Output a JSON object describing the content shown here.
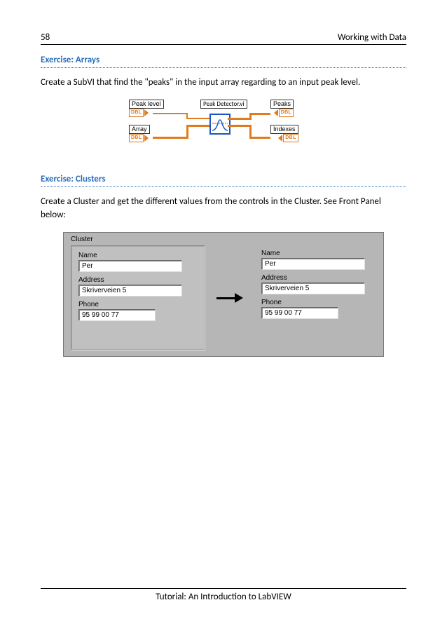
{
  "header": {
    "page_number": "58",
    "chapter": "Working with Data"
  },
  "section1": {
    "heading": "Exercise: Arrays",
    "body": "Create a SubVI that find the \"peaks\" in the input array regarding to an input peak level."
  },
  "diagram1": {
    "peak_level_label": "Peak level",
    "array_label": "Array",
    "center_label": "Peak Detector.vi",
    "peaks_label": "Peaks",
    "indexes_label": "Indexes",
    "dbl": "DBL"
  },
  "section2": {
    "heading": "Exercise: Clusters",
    "body": "Create a Cluster and get the different values from the controls in the Cluster. See Front Panel below:"
  },
  "front_panel": {
    "cluster_label": "Cluster",
    "fields": {
      "name_label": "Name",
      "name_value": "Per",
      "address_label": "Address",
      "address_value": "Skriverveien 5",
      "phone_label": "Phone",
      "phone_value": "95 99 00 77"
    }
  },
  "footer": "Tutorial: An Introduction to LabVIEW"
}
